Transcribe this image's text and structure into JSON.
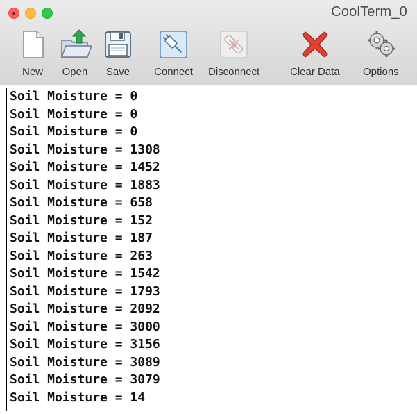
{
  "window": {
    "title": "CoolTerm_0"
  },
  "toolbar": {
    "items": [
      {
        "label": "New",
        "icon": "new-document-icon"
      },
      {
        "label": "Open",
        "icon": "open-folder-icon"
      },
      {
        "label": "Save",
        "icon": "save-floppy-icon"
      },
      {
        "label": "Connect",
        "icon": "connect-plug-icon"
      },
      {
        "label": "Disconnect",
        "icon": "disconnect-plug-icon"
      },
      {
        "label": "Clear Data",
        "icon": "clear-x-icon"
      },
      {
        "label": "Options",
        "icon": "gears-icon"
      }
    ]
  },
  "terminal": {
    "lines": [
      "Soil Moisture = 0",
      "Soil Moisture = 0",
      "Soil Moisture = 0",
      "Soil Moisture = 1308",
      "Soil Moisture = 1452",
      "Soil Moisture = 1883",
      "Soil Moisture = 658",
      "Soil Moisture = 152",
      "Soil Moisture = 187",
      "Soil Moisture = 263",
      "Soil Moisture = 1542",
      "Soil Moisture = 1793",
      "Soil Moisture = 2092",
      "Soil Moisture = 3000",
      "Soil Moisture = 3156",
      "Soil Moisture = 3089",
      "Soil Moisture = 3079",
      "Soil Moisture = 14"
    ]
  },
  "colors": {
    "close": "#fc605c",
    "minimize": "#fdbc40",
    "maximize": "#34c84a",
    "clear_x": "#e2412f",
    "connect_accent": "#4aa3df"
  }
}
